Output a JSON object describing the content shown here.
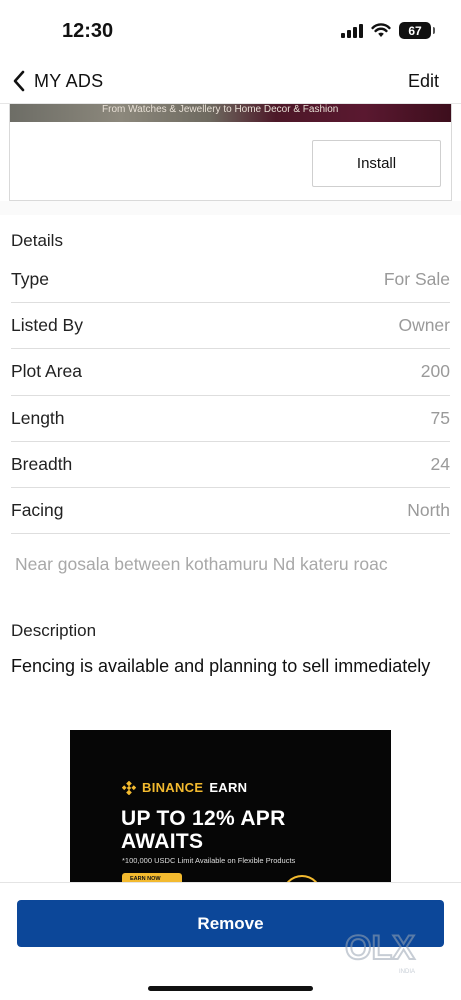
{
  "status_bar": {
    "time": "12:30",
    "battery": "67",
    "icons": [
      "cellular-signal-icon",
      "wifi-icon",
      "battery-icon"
    ]
  },
  "header": {
    "title": "MY ADS",
    "edit_label": "Edit",
    "back_icon": "chevron-left-icon"
  },
  "ad_card": {
    "banner_text": "From Watches & Jewellery to Home Decor & Fashion",
    "install_label": "Install"
  },
  "details": {
    "heading": "Details",
    "rows": [
      {
        "label": "Type",
        "value": "For Sale"
      },
      {
        "label": "Listed By",
        "value": "Owner"
      },
      {
        "label": "Plot Area",
        "value": "200"
      },
      {
        "label": "Length",
        "value": "75"
      },
      {
        "label": "Breadth",
        "value": "24"
      },
      {
        "label": "Facing",
        "value": "North"
      }
    ],
    "location": "Near gosala between kothamuru Nd kateru roac"
  },
  "description": {
    "heading": "Description",
    "text": "Fencing is available and planning to sell immediately"
  },
  "promo": {
    "brand": "BINANCE",
    "brand_suffix": "EARN",
    "headline_line1": "UP TO 12% APR",
    "headline_line2": "AWAITS",
    "subtext": "*100,000 USDC Limit Available on Flexible Products",
    "cta": "EARN NOW"
  },
  "bottom": {
    "remove_label": "Remove",
    "logo_text": "OLX",
    "logo_sub": "INDIA"
  },
  "colors": {
    "primary_button": "#0c4799",
    "binance_yellow": "#f3ba2f",
    "muted_value": "#9a9a9a"
  }
}
